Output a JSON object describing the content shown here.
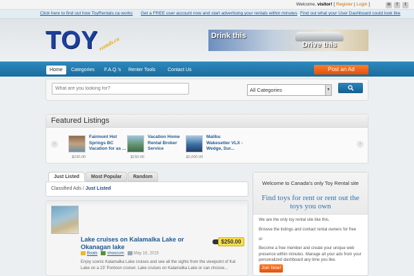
{
  "topbar": {
    "welcome_prefix": "Welcome,",
    "visitor": "visitor!",
    "register": "Register",
    "login": "Login"
  },
  "promo_links": [
    "Click here to find out how ToyRentals.ca works",
    "Get a FREE user account now and start advertising your rentals within minutes",
    "Find out what your User Dashboard could look like"
  ],
  "logo": {
    "main": "TOY",
    "sub": "rentals.ca"
  },
  "banner": {
    "line1": "Drink this",
    "line2": "Drive this"
  },
  "nav": {
    "items": [
      "Home",
      "Categories",
      "F.A.Q.'s",
      "Renter Tools",
      "Contact Us"
    ],
    "active": "Home",
    "post_ad": "Post an Ad"
  },
  "search": {
    "placeholder": "What are you looking for?",
    "category": "All Categories",
    "button_icon": "search-icon"
  },
  "featured": {
    "title": "Featured Listings",
    "items": [
      {
        "title": "Fairmont Hot Springs BC Vacation for as ...",
        "price": "$150.00"
      },
      {
        "title": "Vacation Home Rental Broker Service",
        "price": "$150.00"
      },
      {
        "title": "Malibu Wakesetter VLX - Wedge, Sur...",
        "price": "$2,000.00"
      }
    ]
  },
  "tabs": [
    "Just Listed",
    "Most Popular",
    "Random"
  ],
  "breadcrumb": {
    "root": "Classified Ads",
    "sep": "/",
    "current": "Just Listed"
  },
  "listing": {
    "title": "Lake cruises on Kalamalka Lake or Okanagan lake",
    "price": "$250.00",
    "category": "Boats",
    "author": "shoocum",
    "date": "May 16, 2015",
    "description": "Enjoy scenic Kalamalka Lake cruises and see all the sights from the viewpoint of Kal Lake on a 23' Pontoon cruiser. Lake cruises on Kalamalka Lake or can choose..."
  },
  "sidebar": {
    "welcome": "Welcome to Canada's only Toy Rental site",
    "headline": "Find toys for rent or rent out the toys you own",
    "p1": "We are the only toy rental site like this.",
    "p2": "Browse the listings and contact rental owners for free",
    "p3": "or",
    "p4": "Become a free member and create your unique web presence within minutes. Manage all your ads from your personalized dashboard any time you like.",
    "join": "Join Now!"
  },
  "colors": {
    "nav_blue": "#1f79ab",
    "accent_orange": "#f06a1c",
    "link_blue": "#1c5a93",
    "price_tag": "#f6df4e"
  }
}
